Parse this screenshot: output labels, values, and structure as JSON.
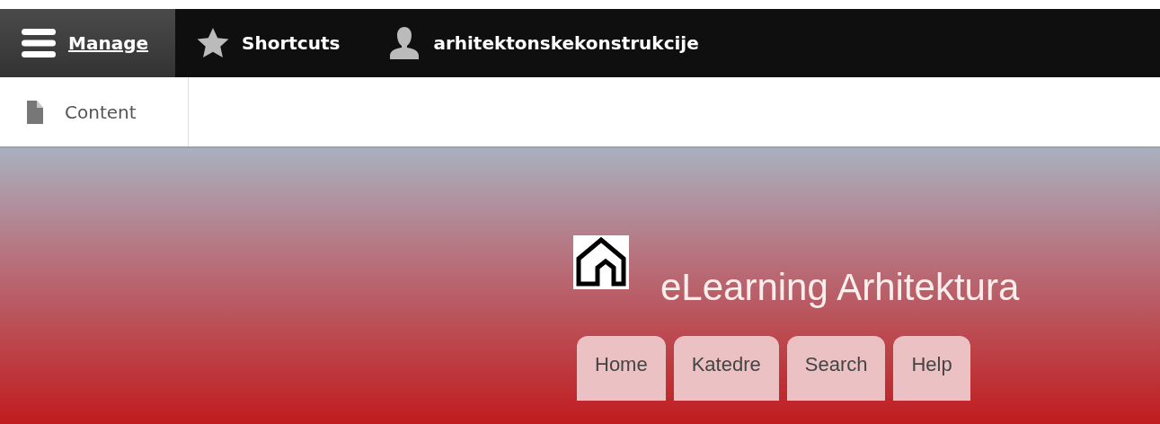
{
  "toolbar": {
    "items": [
      {
        "kind": "menu",
        "label": "Manage",
        "selected": true
      },
      {
        "kind": "star",
        "label": "Shortcuts",
        "selected": false
      },
      {
        "kind": "user",
        "label": "arhitektonskekonstrukcije",
        "selected": false
      }
    ]
  },
  "tray": {
    "items": [
      {
        "label": "Content"
      }
    ]
  },
  "site": {
    "name": "eLearning Arhitektura"
  },
  "nav": {
    "items": [
      {
        "label": "Home"
      },
      {
        "label": "Katedre"
      },
      {
        "label": "Search"
      },
      {
        "label": "Help"
      }
    ]
  }
}
